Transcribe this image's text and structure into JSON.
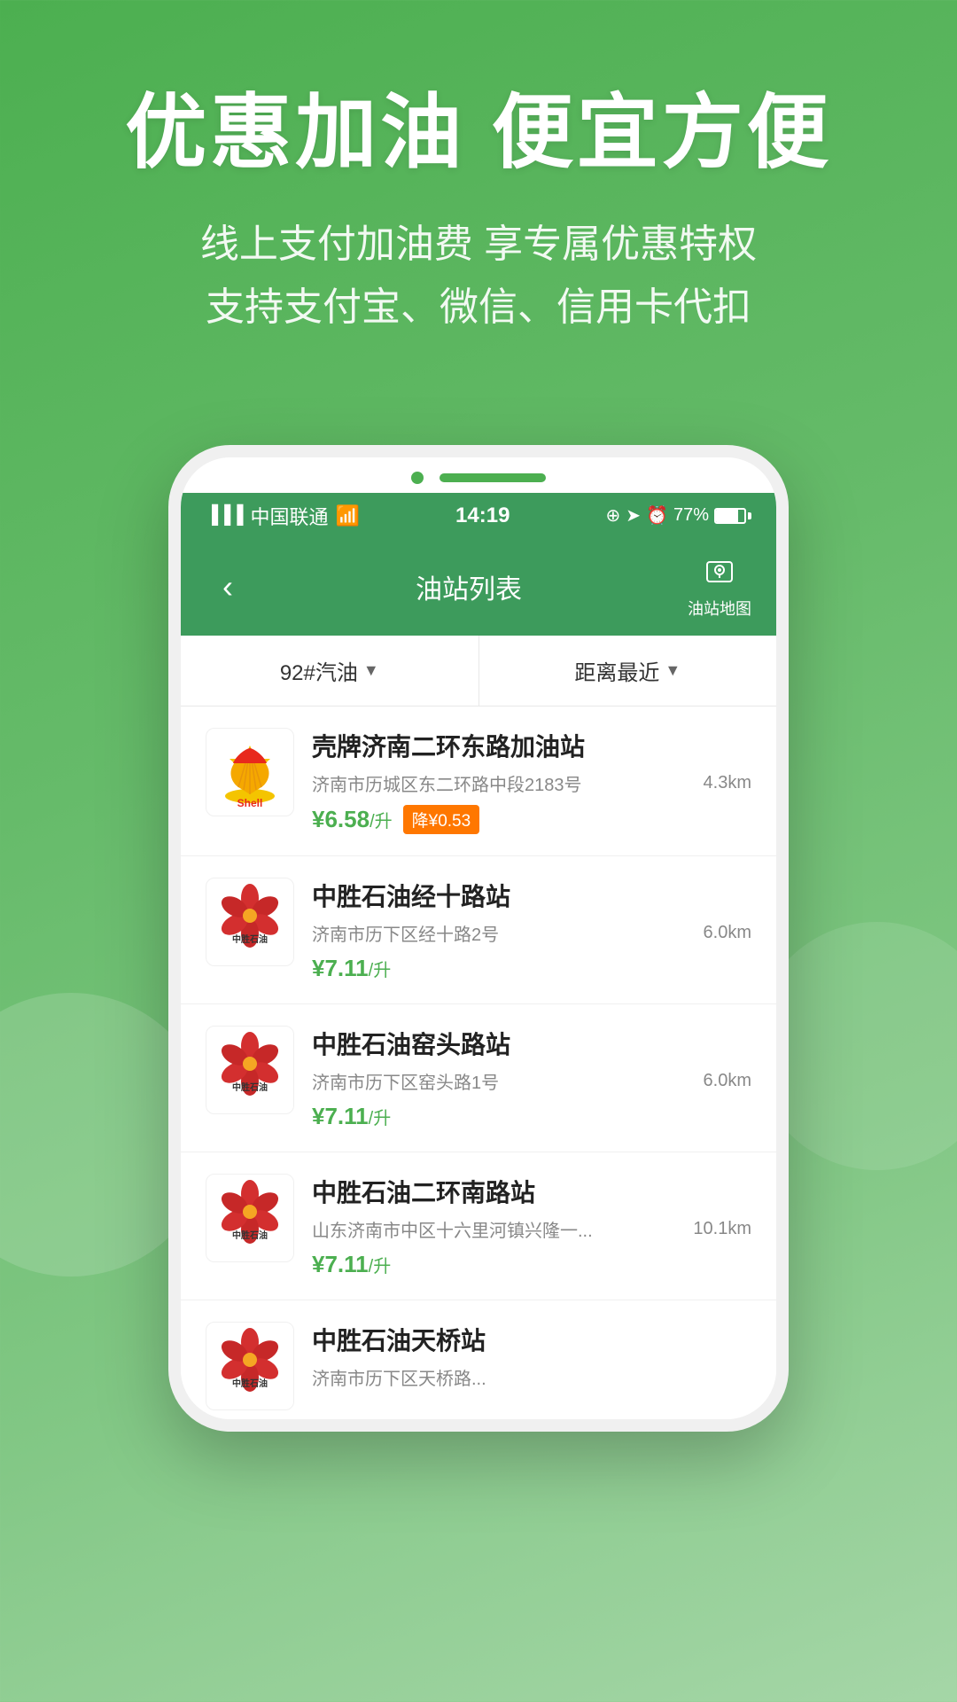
{
  "background": {
    "gradient_start": "#4caf50",
    "gradient_end": "#81c784"
  },
  "hero": {
    "title": "优惠加油 便宜方便",
    "subtitle_line1": "线上支付加油费 享专属优惠特权",
    "subtitle_line2": "支持支付宝、微信、信用卡代扣"
  },
  "phone": {
    "status_bar": {
      "carrier": "中国联通",
      "time": "14:19",
      "battery": "77%"
    },
    "header": {
      "back_label": "‹",
      "title": "油站列表",
      "map_icon_label": "油站地图"
    },
    "filter": {
      "fuel_type": "92#汽油",
      "sort": "距离最近"
    },
    "stations": [
      {
        "id": 1,
        "brand": "Shell",
        "brand_type": "shell",
        "name": "壳牌济南二环东路加油站",
        "address": "济南市历城区东二环路中段2183号",
        "distance": "4.3km",
        "price": "¥6.58",
        "price_unit": "/升",
        "discount": "降¥0.53",
        "has_discount": true
      },
      {
        "id": 2,
        "brand": "中胜石油",
        "brand_type": "zhongsheng",
        "name": "中胜石油经十路站",
        "address": "济南市历下区经十路2号",
        "distance": "6.0km",
        "price": "¥7.11",
        "price_unit": "/升",
        "has_discount": false
      },
      {
        "id": 3,
        "brand": "中胜石油",
        "brand_type": "zhongsheng",
        "name": "中胜石油窑头路站",
        "address": "济南市历下区窑头路1号",
        "distance": "6.0km",
        "price": "¥7.11",
        "price_unit": "/升",
        "has_discount": false
      },
      {
        "id": 4,
        "brand": "中胜石油",
        "brand_type": "zhongsheng",
        "name": "中胜石油二环南路站",
        "address": "山东济南市中区十六里河镇兴隆一...",
        "distance": "10.1km",
        "price": "¥7.11",
        "price_unit": "/升",
        "has_discount": false
      },
      {
        "id": 5,
        "brand": "中胜石油",
        "brand_type": "zhongsheng",
        "name": "中胜石油天桥站",
        "address": "济南市历下区天桥路...",
        "distance": "",
        "price": "",
        "price_unit": "",
        "has_discount": false,
        "partial": true
      }
    ]
  }
}
